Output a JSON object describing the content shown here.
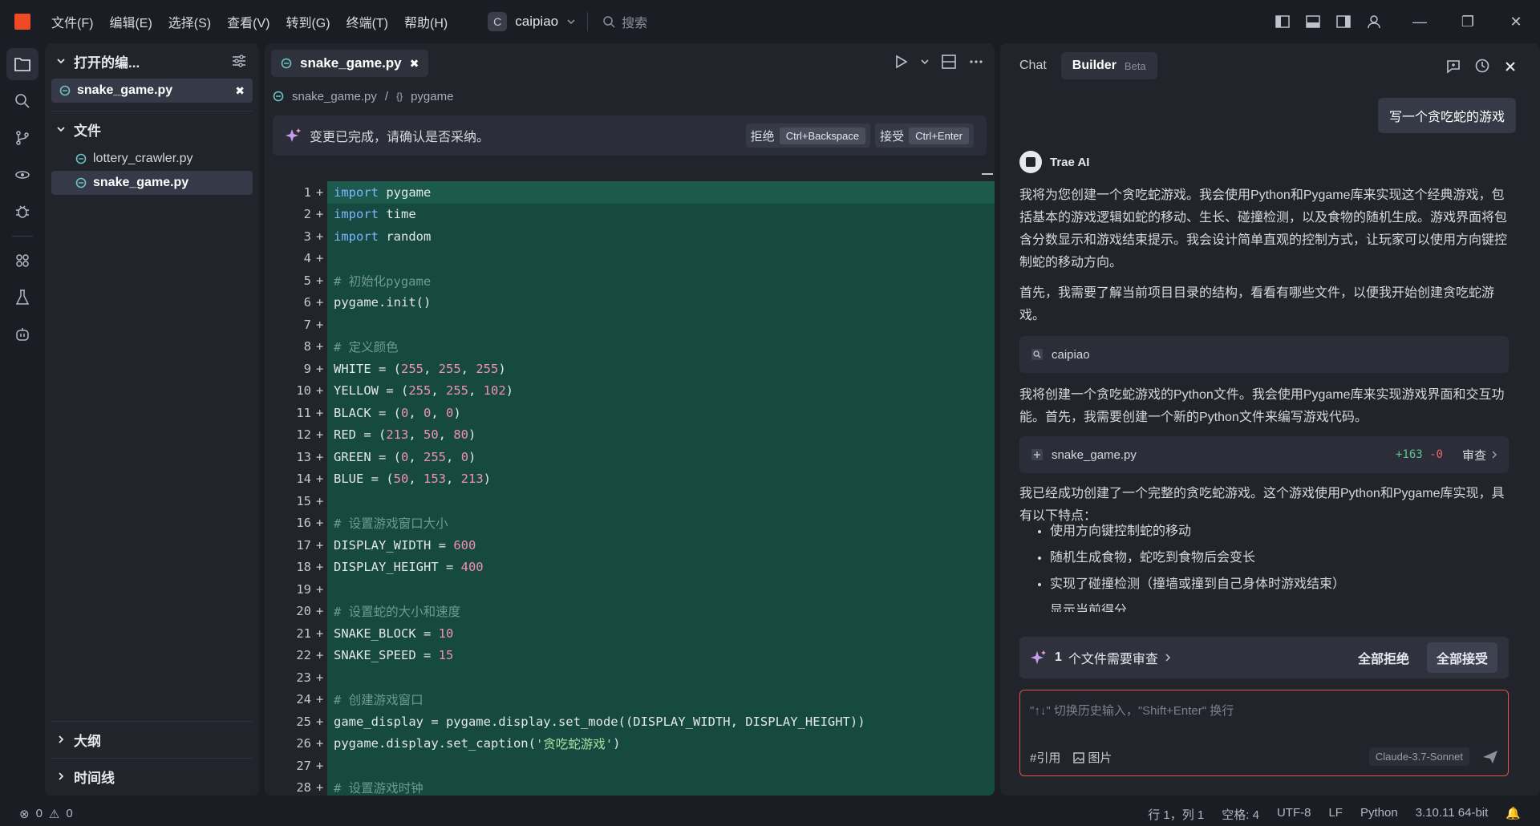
{
  "menu": [
    "文件(F)",
    "编辑(E)",
    "选择(S)",
    "查看(V)",
    "转到(G)",
    "终端(T)",
    "帮助(H)"
  ],
  "project": {
    "badge": "C",
    "name": "caipiao"
  },
  "search_placeholder": "搜索",
  "explorer": {
    "open_editors_title": "打开的编...",
    "open_file": "snake_game.py",
    "files_title": "文件",
    "files": [
      "lottery_crawler.py",
      "snake_game.py"
    ],
    "outline_title": "大纲",
    "timeline_title": "时间线"
  },
  "editor": {
    "tab_label": "snake_game.py",
    "breadcrumb_file": "snake_game.py",
    "breadcrumb_symbol": "pygame",
    "notice_text": "变更已完成，请确认是否采纳。",
    "reject_label": "拒绝",
    "reject_kbd": "Ctrl+Backspace",
    "accept_label": "接受",
    "accept_kbd": "Ctrl+Enter",
    "lines": [
      {
        "n": "1",
        "code": "import pygame"
      },
      {
        "n": "2",
        "code": "import time"
      },
      {
        "n": "3",
        "code": "import random"
      },
      {
        "n": "4",
        "code": ""
      },
      {
        "n": "5",
        "code": "# 初始化pygame"
      },
      {
        "n": "6",
        "code": "pygame.init()"
      },
      {
        "n": "7",
        "code": ""
      },
      {
        "n": "8",
        "code": "# 定义颜色"
      },
      {
        "n": "9",
        "code": "WHITE = (255, 255, 255)"
      },
      {
        "n": "10",
        "code": "YELLOW = (255, 255, 102)"
      },
      {
        "n": "11",
        "code": "BLACK = (0, 0, 0)"
      },
      {
        "n": "12",
        "code": "RED = (213, 50, 80)"
      },
      {
        "n": "13",
        "code": "GREEN = (0, 255, 0)"
      },
      {
        "n": "14",
        "code": "BLUE = (50, 153, 213)"
      },
      {
        "n": "15",
        "code": ""
      },
      {
        "n": "16",
        "code": "# 设置游戏窗口大小"
      },
      {
        "n": "17",
        "code": "DISPLAY_WIDTH = 600"
      },
      {
        "n": "18",
        "code": "DISPLAY_HEIGHT = 400"
      },
      {
        "n": "19",
        "code": ""
      },
      {
        "n": "20",
        "code": "# 设置蛇的大小和速度"
      },
      {
        "n": "21",
        "code": "SNAKE_BLOCK = 10"
      },
      {
        "n": "22",
        "code": "SNAKE_SPEED = 15"
      },
      {
        "n": "23",
        "code": ""
      },
      {
        "n": "24",
        "code": "# 创建游戏窗口"
      },
      {
        "n": "25",
        "code": "game_display = pygame.display.set_mode((DISPLAY_WIDTH, DISPLAY_HEIGHT))"
      },
      {
        "n": "26",
        "code": "pygame.display.set_caption('贪吃蛇游戏')"
      },
      {
        "n": "27",
        "code": ""
      },
      {
        "n": "28",
        "code": "# 设置游戏时钟"
      }
    ]
  },
  "chat": {
    "tab_chat": "Chat",
    "tab_builder": "Builder",
    "beta": "Beta",
    "user_msg": "写一个贪吃蛇的游戏",
    "ai_name": "Trae AI",
    "para1": "我将为您创建一个贪吃蛇游戏。我会使用Python和Pygame库来实现这个经典游戏，包括基本的游戏逻辑如蛇的移动、生长、碰撞检测，以及食物的随机生成。游戏界面将包含分数显示和游戏结束提示。我会设计简单直观的控制方式，让玩家可以使用方向键控制蛇的移动方向。",
    "para2": "首先，我需要了解当前项目目录的结构，看看有哪些文件，以便我开始创建贪吃蛇游戏。",
    "search_card": "caipiao",
    "para3": "我将创建一个贪吃蛇游戏的Python文件。我会使用Pygame库来实现游戏界面和交互功能。首先，我需要创建一个新的Python文件来编写游戏代码。",
    "file_card": "snake_game.py",
    "diff_add": "+163",
    "diff_del": "-0",
    "review_label": "审查",
    "para4": "我已经成功创建了一个完整的贪吃蛇游戏。这个游戏使用Python和Pygame库实现，具有以下特点：",
    "features": [
      "使用方向键控制蛇的移动",
      "随机生成食物，蛇吃到食物后会变长",
      "实现了碰撞检测（撞墙或撞到自己身体时游戏结束）",
      "显示当前得分"
    ],
    "review_count": "1",
    "review_text": "个文件需要审查",
    "reject_all": "全部拒绝",
    "accept_all": "全部接受",
    "input_placeholder": "\"↑↓\" 切换历史输入，\"Shift+Enter\" 换行",
    "quote_label": "#引用",
    "image_label": "图片",
    "model": "Claude-3.7-Sonnet"
  },
  "status": {
    "errors": "0",
    "warnings": "0",
    "position": "行 1，列 1",
    "spaces": "空格: 4",
    "encoding": "UTF-8",
    "eol": "LF",
    "language": "Python",
    "interpreter": "3.10.11 64-bit"
  }
}
